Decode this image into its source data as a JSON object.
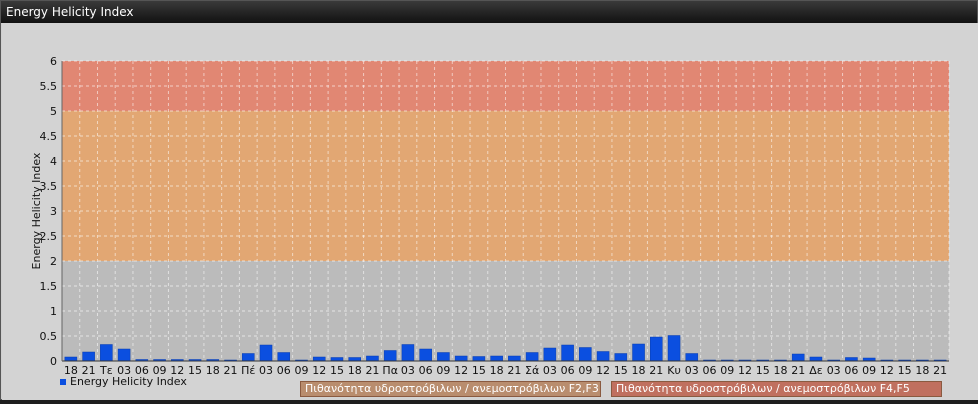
{
  "window": {
    "title": "Energy Helicity Index"
  },
  "legend": {
    "series_label": "Energy Helicity Index"
  },
  "bands": [
    {
      "from": 0,
      "to": 2,
      "color": "#b8b8b8",
      "label": ""
    },
    {
      "from": 2,
      "to": 5,
      "color": "#e3a36a",
      "label": "Πιθανότητα υδροστρόβιλων / ανεμοστρόβιλων F2,F3"
    },
    {
      "from": 5,
      "to": 6,
      "color": "#e2806a",
      "label": "Πιθανότητα υδροστρόβιλων / ανεμοστρόβιλων F4,F5"
    }
  ],
  "chart_data": {
    "type": "bar",
    "title": "",
    "ylabel": "Energy Helicity Index",
    "xlabel": "",
    "ylim": [
      0,
      6
    ],
    "yticks": [
      "0",
      "0.5",
      "1",
      "1.5",
      "2",
      "2.5",
      "3",
      "3.5",
      "4",
      "4.5",
      "5",
      "5.5",
      "6"
    ],
    "grid": true,
    "legend_position": "bottom-left",
    "bar_color": "#0b4fe0",
    "categories": [
      "18",
      "21",
      "Τε",
      "03",
      "06",
      "09",
      "12",
      "15",
      "18",
      "21",
      "Πέ",
      "03",
      "06",
      "09",
      "12",
      "15",
      "18",
      "21",
      "Πα",
      "03",
      "06",
      "09",
      "12",
      "15",
      "18",
      "21",
      "Σά",
      "03",
      "06",
      "09",
      "12",
      "15",
      "18",
      "21",
      "Κυ",
      "03",
      "06",
      "09",
      "12",
      "15",
      "18",
      "21",
      "Δε",
      "03",
      "06",
      "09",
      "12",
      "15",
      "18",
      "21"
    ],
    "series": [
      {
        "name": "Energy Helicity Index",
        "values": [
          0.08,
          0.18,
          0.33,
          0.24,
          0.03,
          0.03,
          0.03,
          0.03,
          0.03,
          0.02,
          0.15,
          0.32,
          0.17,
          0.02,
          0.08,
          0.07,
          0.07,
          0.1,
          0.21,
          0.33,
          0.24,
          0.17,
          0.1,
          0.09,
          0.1,
          0.1,
          0.17,
          0.26,
          0.32,
          0.27,
          0.19,
          0.15,
          0.34,
          0.48,
          0.51,
          0.15,
          0.02,
          0.02,
          0.02,
          0.02,
          0.02,
          0.14,
          0.08,
          0.02,
          0.07,
          0.06,
          0.02,
          0.02,
          0.02,
          0.02
        ]
      }
    ]
  }
}
